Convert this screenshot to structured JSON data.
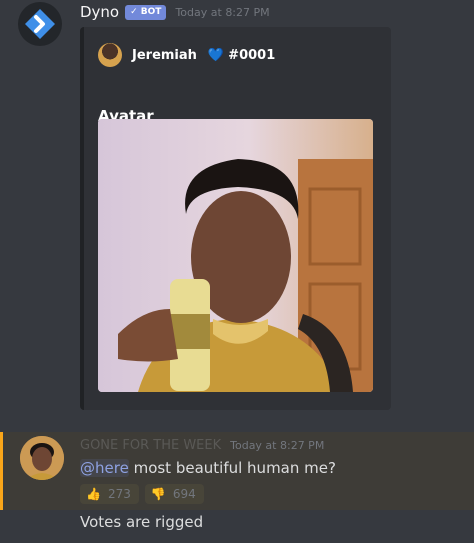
{
  "message1": {
    "username": "Dyno",
    "bot_tag": "✓ BOT",
    "timestamp": "Today at 8:27 PM",
    "embed": {
      "author_name": "Jeremiah",
      "author_tag": "#0001",
      "heart": "💙",
      "title": "Avatar"
    }
  },
  "message2": {
    "username": "GONE FOR THE WEEK",
    "timestamp": "Today at 8:27 PM",
    "mention": "@here",
    "text": " most beautiful human me?",
    "reactions": [
      {
        "emoji": "👍",
        "count": "273"
      },
      {
        "emoji": "👎",
        "count": "694"
      }
    ]
  },
  "message3": {
    "text": "Votes are rigged"
  }
}
